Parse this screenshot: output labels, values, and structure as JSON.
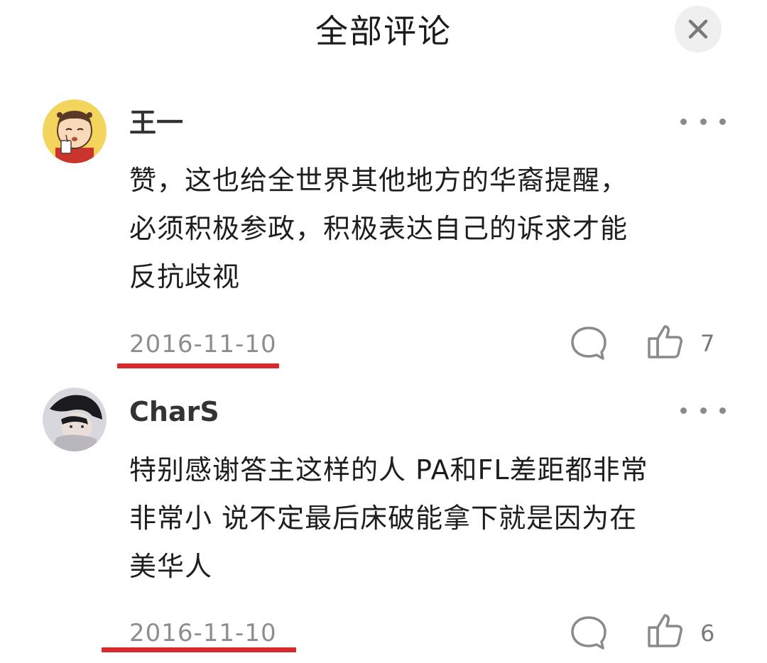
{
  "header": {
    "title": "全部评论",
    "close_icon": "close-icon"
  },
  "comments": [
    {
      "username": "王一",
      "text_lines": [
        "赞，这也给全世界其他地方的华裔提醒，",
        "必须积极参政，积极表达自己的诉求才能",
        "反抗歧视"
      ],
      "date": "2016-11-10",
      "likes": "7",
      "avatar_icon": "cartoon-boy-avatar"
    },
    {
      "username": "CharS",
      "text_lines": [
        "特别感谢答主这样的人 PA和FL差距都非常",
        "非常小 说不定最后床破能拿下就是因为在",
        "美华人"
      ],
      "date": "2016-11-10",
      "likes": "6",
      "avatar_icon": "photo-avatar"
    }
  ],
  "colors": {
    "underline": "#d8292f",
    "date_text": "#8e8e8e",
    "icon_gray": "#8a8a8a"
  }
}
